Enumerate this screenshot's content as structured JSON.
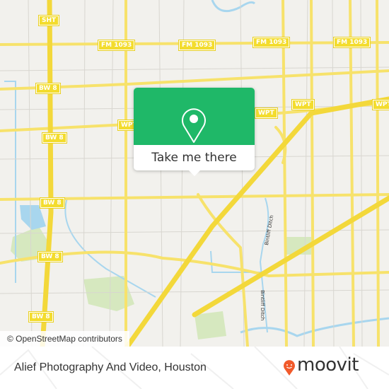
{
  "map": {
    "road_labels": [
      "SHT",
      "FM 1093",
      "FM 1093",
      "FM 1093",
      "FM 1093",
      "BW 8",
      "BW 8",
      "WPT",
      "WPT",
      "WPT",
      "BW 8",
      "BW 8",
      "BW 8"
    ],
    "waterway_labels": [
      "Bintliff Ditch",
      "Bintliff Ditch"
    ],
    "attribution": "© OpenStreetMap contributors",
    "colors": {
      "road": "#f7e26b",
      "land": "#f2f1ed",
      "water": "#a8d6ee",
      "park": "#cfe5b0"
    }
  },
  "popup": {
    "icon": "map-pin-icon",
    "button_label": "Take me there",
    "color": "#1fb868"
  },
  "footer": {
    "place_name": "Alief Photography And Video, Houston",
    "brand": "moovit",
    "brand_icon": "moovit-pin-icon",
    "brand_color": "#f15a2b"
  }
}
